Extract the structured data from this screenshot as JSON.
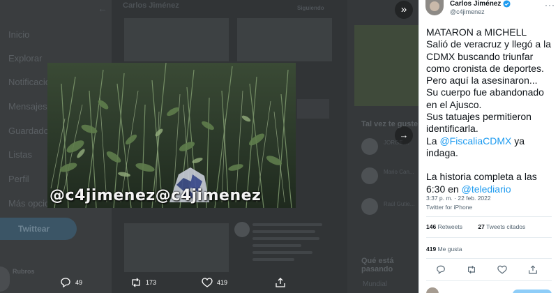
{
  "background": {
    "nav": [
      "Inicio",
      "Explorar",
      "Notificaciones",
      "Mensajes",
      "Guardados",
      "Listas",
      "Perfil",
      "Más opciones"
    ],
    "tweet_button": "Twittear",
    "profile_name": "Rubros",
    "center_header": "Carlos Jiménez",
    "follow_label": "Siguiendo",
    "right_heading_1": "Tal vez te guste",
    "right_heading_2": "Qué está pasando",
    "right_names": [
      "JORGE ...",
      "Mario Can...",
      "Raúl Gutie..."
    ],
    "right_bottom": "Mundial"
  },
  "photo": {
    "watermark": "@c4jimenez@c4jimenez"
  },
  "modal_actions": {
    "replies": "49",
    "retweets": "173",
    "likes": "419"
  },
  "tweet": {
    "author_name": "Carlos Jiménez",
    "author_handle": "@c4jimenez",
    "lines": {
      "headline": "MATARON a MICHELL",
      "p1": "Salió de veracruz y llegó a la CDMX buscando triunfar como cronista de deportes.",
      "p2": "Pero aquí la asesinaron...",
      "p3": "Su cuerpo fue abandonado en el Ajusco.",
      "p4": "Sus tatuajes permitieron identificarla.",
      "p5_prefix": "La ",
      "p5_mention": "@FiscaliaCDMX",
      "p5_suffix": " ya indaga.",
      "p6_prefix": "La historia completa a las 6:30 en ",
      "p6_mention": "@telediario"
    },
    "time": "3:37 p. m. · 22 feb. 2022",
    "source": "Twitter for iPhone",
    "retweets_count": "146",
    "retweets_label": "Retweets",
    "quotes_count": "27",
    "quotes_label": "Tweets citados",
    "likes_count": "419",
    "likes_label": "Me gusta"
  },
  "colors": {
    "link": "#1d9bf0",
    "verified": "#1d9bf0",
    "overlay": "#2a2d2f"
  },
  "icons": [
    "back-arrow-icon",
    "collapse-icon",
    "next-arrow-icon",
    "reply-icon",
    "retweet-icon",
    "like-icon",
    "share-icon",
    "verified-icon",
    "more-icon"
  ]
}
